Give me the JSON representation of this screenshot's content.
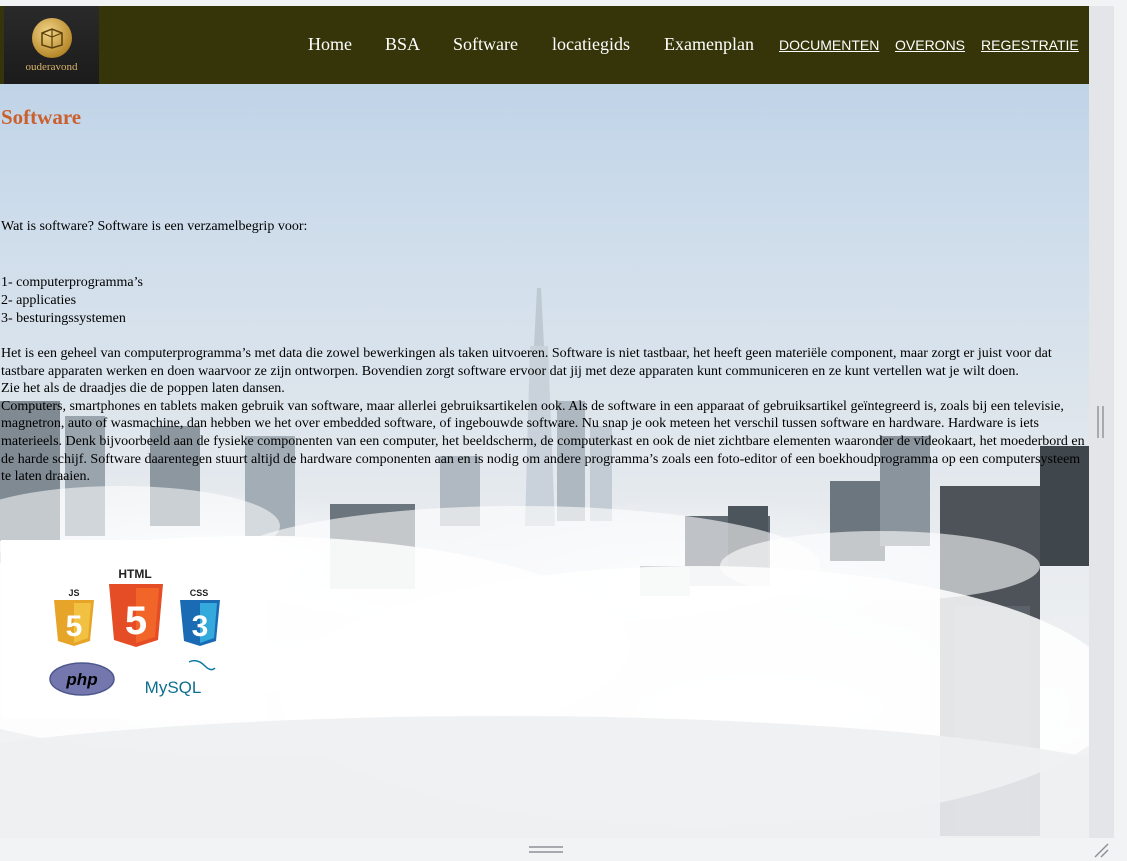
{
  "header": {
    "logo_text": "ouderavond",
    "nav": [
      {
        "label": "Home"
      },
      {
        "label": "BSA"
      },
      {
        "label": "Software"
      },
      {
        "label": "locatiegids"
      },
      {
        "label": "Examenplan"
      },
      {
        "label": "DOCUMENTEN"
      },
      {
        "label": "OVERONS"
      },
      {
        "label": "REGESTRATIE"
      }
    ]
  },
  "main": {
    "title": "Software",
    "intro": "Wat is software? Software is een verzamelbegrip voor:",
    "list": [
      "1- computerprogramma’s",
      "2- applicaties",
      "3- besturingssystemen"
    ],
    "paragraphs": [
      "Het is een geheel van computerprogramma’s met data die zowel bewerkingen als taken uitvoeren. Software is niet tastbaar, het heeft geen materiële component, maar zorgt er juist voor dat tastbare apparaten werken en doen waarvoor ze zijn ontworpen. Bovendien zorgt software ervoor dat jij met deze apparaten kunt communiceren en ze kunt vertellen wat je wilt doen.",
      "Zie het als de draadjes die de poppen laten dansen.",
      "Computers, smartphones en tablets maken gebruik van software, maar allerlei gebruiksartikelen ook. Als de software in een apparaat of gebruiksartikel geïntegreerd is, zoals bij een televisie, magnetron, auto of wasmachine, dan hebben we het over embedded software, of ingebouwde software. Nu snap je ook meteen het verschil tussen software en hardware. Hardware is iets materieels. Denk bijvoorbeeld aan de fysieke componenten van een computer, het beeldscherm, de computerkast en ook de niet zichtbare elementen waaronder de videokaart, het moederbord en de harde schijf. Software daarentegen stuurt altijd de hardware componenten aan en is nodig om andere programma’s zoals een foto-editor of een boekhoudprogramma op een computersysteem te laten draaien."
    ],
    "logos": {
      "js": "JS",
      "html": "HTML",
      "css": "CSS",
      "php": "php",
      "mysql": "MySQL"
    }
  },
  "colors": {
    "header_bg": "#353509",
    "title": "#c9602e",
    "nav_text": "#ffffff"
  }
}
